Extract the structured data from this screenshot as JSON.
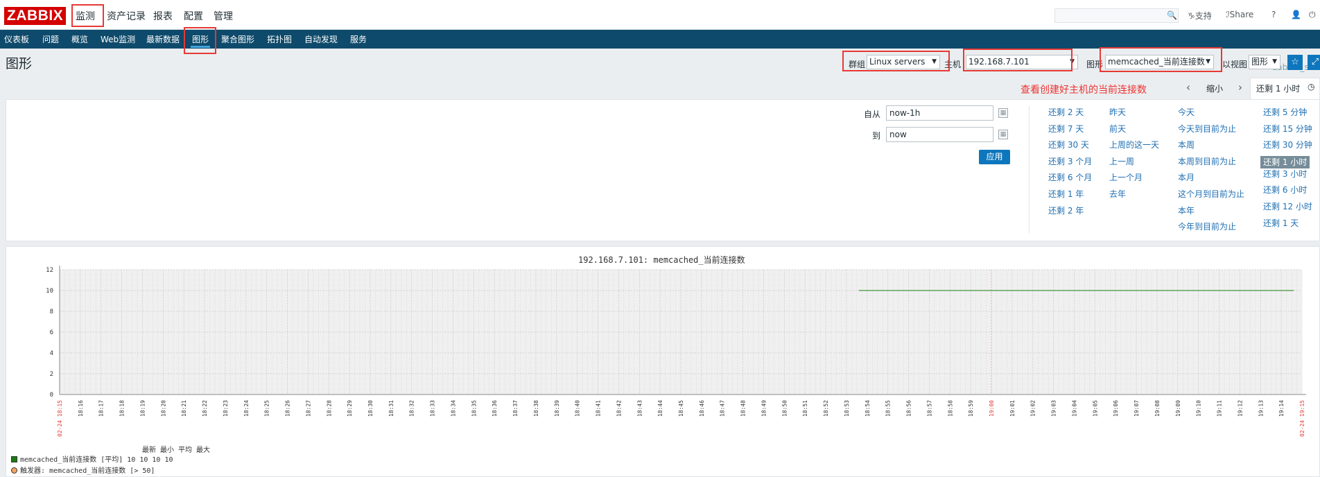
{
  "header": {
    "logo": "ZABBIX",
    "menu": [
      "监测",
      "资产记录",
      "报表",
      "配置",
      "管理"
    ],
    "support": "支持",
    "share": "Share",
    "help": "?",
    "user_icon": "user-icon",
    "logout_icon": "power-icon"
  },
  "subnav": {
    "items": [
      "仪表板",
      "问题",
      "概览",
      "Web监测",
      "最新数据",
      "图形",
      "聚合图形",
      "拓扑图",
      "自动发现",
      "服务"
    ],
    "active": "图形",
    "server": "zabbix_server"
  },
  "page": {
    "title": "图形",
    "group_label": "群组",
    "group_value": "Linux servers",
    "host_label": "主机",
    "host_value": "192.168.7.101",
    "graph_label": "图形",
    "graph_value": "memcached_当前连接数",
    "view_label": "以视图",
    "view_value": "图形",
    "annotation": "查看创建好主机的当前连接数"
  },
  "timebar": {
    "zoom_out": "缩小",
    "current": "还剩 1 小时",
    "from_label": "自从",
    "from_value": "now-1h",
    "to_label": "到",
    "to_value": "now",
    "apply": "应用"
  },
  "quick_ranges": [
    [
      "还剩 2 天",
      "还剩 7 天",
      "还剩 30 天",
      "还剩 3 个月",
      "还剩 6 个月",
      "还剩 1 年",
      "还剩 2 年"
    ],
    [
      "昨天",
      "前天",
      "上周的这一天",
      "上一周",
      "上一个月",
      "去年"
    ],
    [
      "今天",
      "今天到目前为止",
      "本周",
      "本周到目前为止",
      "本月",
      "这个月到目前为止",
      "本年",
      "今年到目前为止"
    ],
    [
      "还剩 5 分钟",
      "还剩 15 分钟",
      "还剩 30 分钟",
      "还剩 1 小时",
      "还剩 3 小时",
      "还剩 6 小时",
      "还剩 12 小时",
      "还剩 1 天"
    ]
  ],
  "legend": {
    "head": "最新  最小  平均  最大",
    "row1": "memcached_当前连接数  [平均]    10    10    10    10",
    "row2": "触发器: memcached_当前连接数   [> 50]"
  },
  "colors": {
    "series": "#1a7c11",
    "nav": "#0e4a6b",
    "accent": "#0e76bc"
  },
  "chart_data": {
    "type": "line",
    "title": "192.168.7.101: memcached_当前连接数",
    "ylim": [
      0,
      12
    ],
    "yticks": [
      0,
      2,
      4,
      6,
      8,
      10,
      12
    ],
    "xticks": [
      "18:16",
      "18:17",
      "18:18",
      "18:19",
      "18:20",
      "18:21",
      "18:22",
      "18:23",
      "18:24",
      "18:25",
      "18:26",
      "18:27",
      "18:28",
      "18:29",
      "18:30",
      "18:31",
      "18:32",
      "18:33",
      "18:34",
      "18:35",
      "18:36",
      "18:37",
      "18:38",
      "18:39",
      "18:40",
      "18:41",
      "18:42",
      "18:43",
      "18:44",
      "18:45",
      "18:46",
      "18:47",
      "18:48",
      "18:49",
      "18:50",
      "18:51",
      "18:52",
      "18:53",
      "18:54",
      "18:55",
      "18:56",
      "18:57",
      "18:58",
      "18:59",
      "19:00",
      "19:01",
      "19:02",
      "19:03",
      "19:04",
      "19:05",
      "19:06",
      "19:07",
      "19:08",
      "19:09",
      "19:10",
      "19:11",
      "19:12",
      "19:13",
      "19:14"
    ],
    "x_start": "02-24 18:15",
    "x_end": "02-24 19:15",
    "series": [
      {
        "name": "memcached_当前连接数",
        "x_from": "18:53.6",
        "x_to": "19:14.6",
        "value": 10
      }
    ],
    "grid": true
  }
}
